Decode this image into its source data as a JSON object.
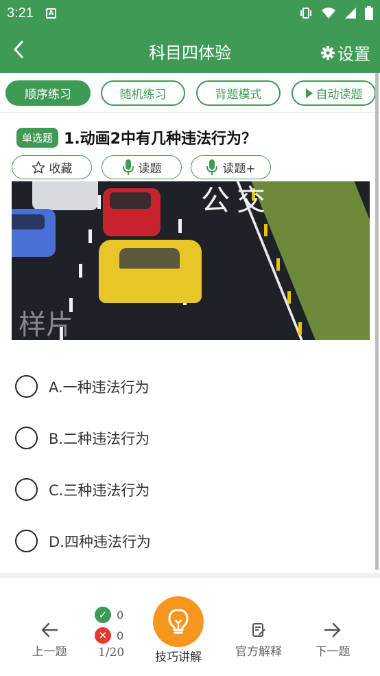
{
  "status_bar": {
    "time": "3:21",
    "notification_badge": "A",
    "icons": [
      "vibrate-icon",
      "wifi-icon",
      "signal-icon",
      "battery-icon"
    ]
  },
  "app_bar": {
    "title": "科目四体验",
    "settings_label": "设置",
    "back_icon": "back-arrow-icon",
    "settings_icon": "gear-icon"
  },
  "tabs": [
    {
      "label": "顺序练习",
      "active": true
    },
    {
      "label": "随机练习",
      "active": false
    },
    {
      "label": "背题模式",
      "active": false
    },
    {
      "label": "自动读题",
      "active": false,
      "icon": "play-icon"
    }
  ],
  "question": {
    "type_badge": "单选题",
    "text": "1.动画2中有几种违法行为？",
    "actions": [
      {
        "label": "收藏",
        "icon": "star-outline-icon"
      },
      {
        "label": "读题",
        "icon": "microphone-icon"
      },
      {
        "label": "读题+",
        "icon": "microphone-icon"
      }
    ],
    "image": {
      "road_marking": "公交",
      "watermark": "样片"
    }
  },
  "options": [
    {
      "label": "A.一种违法行为"
    },
    {
      "label": "B.二种违法行为"
    },
    {
      "label": "C.三种违法行为"
    },
    {
      "label": "D.四种违法行为"
    }
  ],
  "bottom_bar": {
    "prev_label": "上一题",
    "correct_count": "0",
    "wrong_count": "0",
    "progress": "1/20",
    "tips_label": "技巧讲解",
    "official_label": "官方解释",
    "next_label": "下一题"
  },
  "colors": {
    "primary": "#3f9a55",
    "tip_button": "#f7961e",
    "wrong": "#e53935"
  }
}
